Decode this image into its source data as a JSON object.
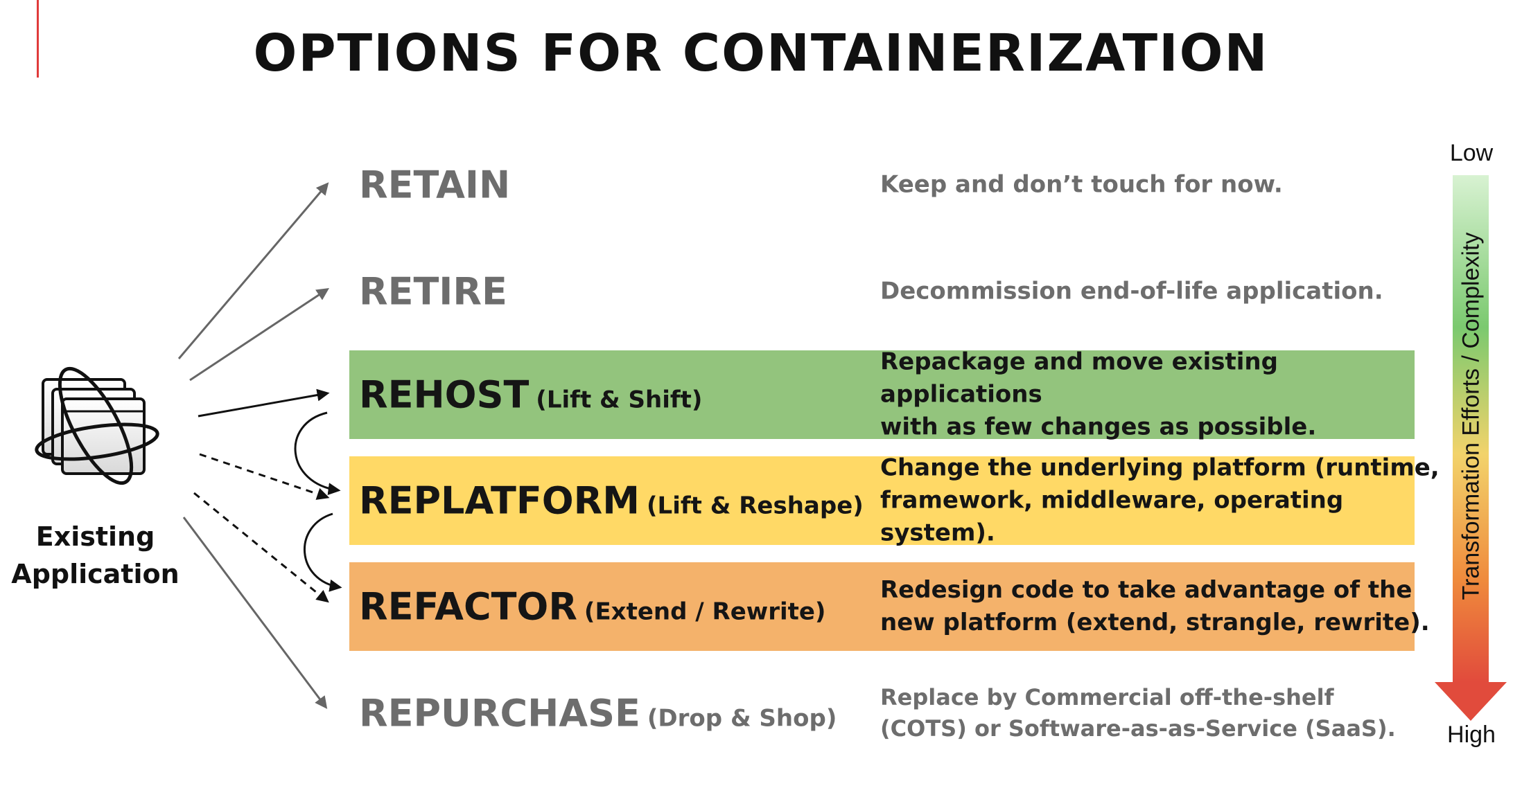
{
  "title": "OPTIONS FOR CONTAINERIZATION",
  "source": {
    "label_line1": "Existing",
    "label_line2": "Application"
  },
  "options": [
    {
      "name": "RETAIN",
      "subtitle": "",
      "description_lines": [
        "Keep and don’t touch for now."
      ],
      "band_color": "none"
    },
    {
      "name": "RETIRE",
      "subtitle": "",
      "description_lines": [
        "Decommission end-of-life application."
      ],
      "band_color": "none"
    },
    {
      "name": "REHOST",
      "subtitle": "(Lift & Shift)",
      "description_lines": [
        "Repackage and move existing",
        "applications",
        "with as few changes as possible."
      ],
      "band_color": "#93c47d"
    },
    {
      "name": "REPLATFORM",
      "subtitle": "(Lift & Reshape)",
      "description_lines": [
        "Change the underlying platform (runtime,",
        "framework, middleware, operating",
        "system)."
      ],
      "band_color": "#ffd966"
    },
    {
      "name": "REFACTOR",
      "subtitle": "(Extend / Rewrite)",
      "description_lines": [
        "Redesign code to take advantage of the",
        "new platform (extend, strangle, rewrite)."
      ],
      "band_color": "#f4b26b"
    },
    {
      "name": "REPURCHASE",
      "subtitle": "(Drop & Shop)",
      "description_lines": [
        "Replace by Commercial off-the-shelf",
        "(COTS) or Software-as-as-Service (SaaS)."
      ],
      "band_color": "none"
    }
  ],
  "scale": {
    "low_label": "Low",
    "high_label": "High",
    "axis_label": "Transformation  Efforts / Complexity",
    "gradient_colors": [
      "#d8f2d2",
      "#7bc96f",
      "#f2d36b",
      "#ef8a3c",
      "#e14b3c"
    ]
  },
  "icons": {
    "source_icon": "stacked-windows-orbit-icon"
  }
}
